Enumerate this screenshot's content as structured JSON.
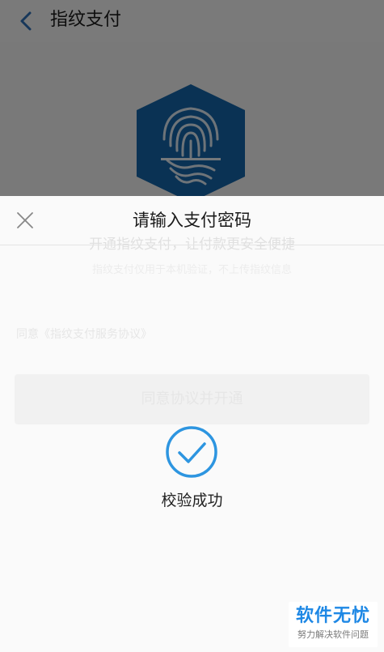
{
  "background_page": {
    "title": "指纹支付",
    "ghost_line_1": "开通指纹支付，让付款更安全便捷",
    "ghost_line_2": "指纹支付仅用于本机验证，不上传指纹信息",
    "ghost_line_3": "同意《指纹支付服务协议》",
    "ghost_button_label": "同意协议并开通"
  },
  "sheet": {
    "title": "请输入支付密码",
    "success_text": "校验成功"
  },
  "watermark": {
    "main": "软件无忧",
    "sub": "努力解决软件问题"
  },
  "colors": {
    "brand_blue": "#1565a8",
    "success_blue": "#2d95e0",
    "watermark_blue": "#1e88e5"
  },
  "icons": {
    "back": "chevron-left-icon",
    "close": "close-icon",
    "logo": "fingerprint-icon",
    "success": "check-circle-icon"
  }
}
